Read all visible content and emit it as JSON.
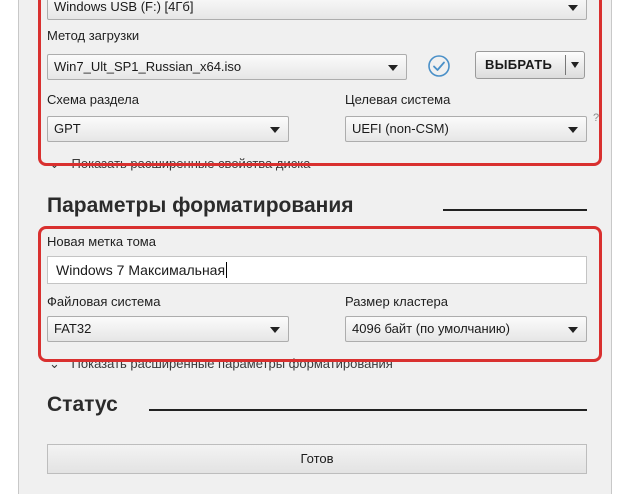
{
  "device": {
    "value": "Windows USB (F:) [4Гб]"
  },
  "boot": {
    "label": "Метод загрузки",
    "value": "Win7_Ult_SP1_Russian_x64.iso",
    "select_button": "ВЫБРАТЬ"
  },
  "partition": {
    "label": "Схема раздела",
    "value": "GPT"
  },
  "target": {
    "label": "Целевая система",
    "value": "UEFI (non-CSM)"
  },
  "drive_advanced": {
    "label": "Показать расширенные свойства диска"
  },
  "format_section": {
    "title": "Параметры форматирования"
  },
  "volume": {
    "label": "Новая метка тома",
    "value": "Windows 7 Максимальная"
  },
  "filesystem": {
    "label": "Файловая система",
    "value": "FAT32"
  },
  "cluster": {
    "label": "Размер кластера",
    "value": "4096 байт (по умолчанию)"
  },
  "format_advanced": {
    "label": "Показать расширенные параметры форматирования"
  },
  "status_section": {
    "title": "Статус",
    "status_text": "Готов"
  },
  "colors": {
    "highlight": "#d9302f",
    "window_bg": "#f0f0f0",
    "check_icon": "#4a90c8"
  }
}
